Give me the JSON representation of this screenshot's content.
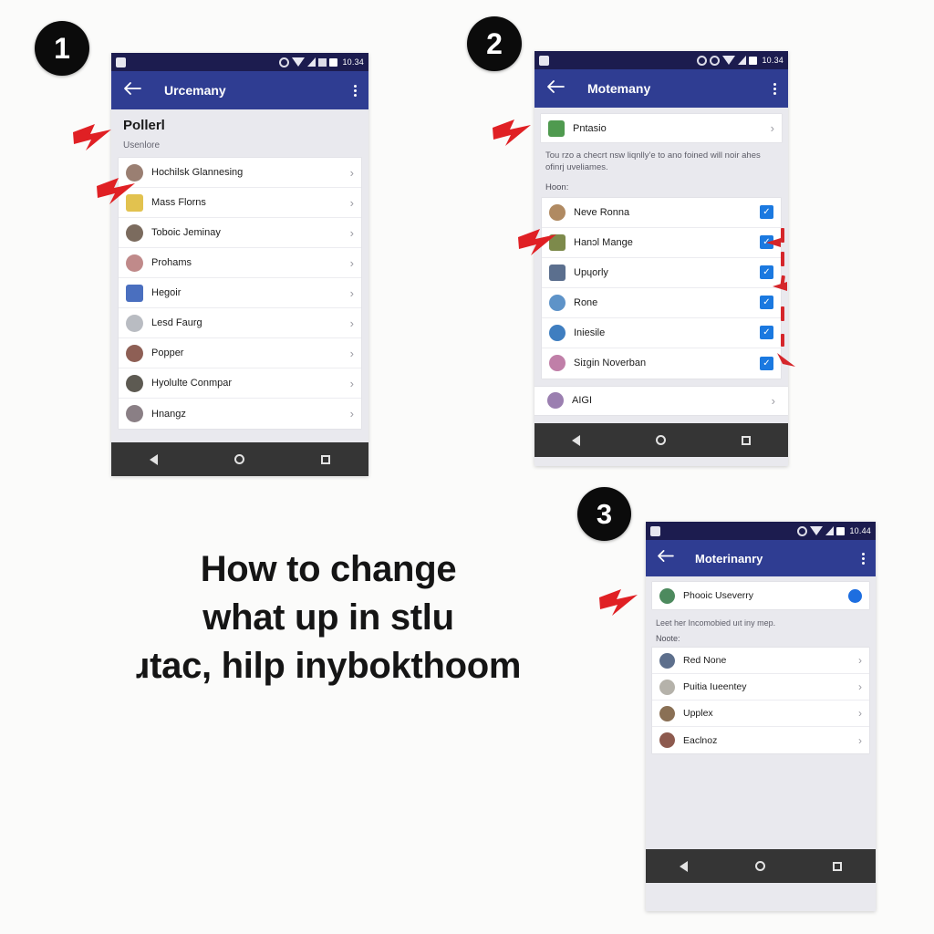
{
  "page": {
    "background": "#fbfbfa",
    "heading_lines": [
      "How to change",
      "what up in stlu",
      "ɹtac, hilp inybokthoom"
    ]
  },
  "colors": {
    "statusbar": "#1c1c4f",
    "appbar": "#2f3d92",
    "checkbox": "#1b79e0",
    "toggle_dot": "#1d6ee0",
    "arrow_red": "#e02024",
    "navbar": "#353535",
    "badge": "#0b0b0b"
  },
  "steps": [
    {
      "number": "1"
    },
    {
      "number": "2"
    },
    {
      "number": "3"
    }
  ],
  "phone1": {
    "statusbar": {
      "time": "10.34",
      "icons": [
        "app-notification-icon",
        "gear-icon",
        "wifi-icon",
        "signal-icon",
        "battery-icon"
      ]
    },
    "appbar": {
      "back_icon": "back-arrow-icon",
      "title": "Urcemany",
      "menu_icon": "overflow-menu-icon"
    },
    "section": {
      "title": "Pollerl",
      "subtitle": "Usenlore"
    },
    "rows": [
      {
        "label": "Hochilsk Glannesing",
        "avatar": "#9a7f72",
        "square": false
      },
      {
        "label": "Mass Florns",
        "avatar": "#e2c24f",
        "square": true
      },
      {
        "label": "Toboic Jeminay",
        "avatar": "#7b6b5e",
        "square": false
      },
      {
        "label": "Prohams",
        "avatar": "#c08a8a",
        "square": false
      },
      {
        "label": "Hegoir",
        "avatar": "#4a6fbf",
        "square": true
      },
      {
        "label": "Lesd Faurg",
        "avatar": "#b9bcc2",
        "square": false
      },
      {
        "label": "Popper",
        "avatar": "#8e5f55",
        "square": false
      },
      {
        "label": "Hyolulte Conmpar",
        "avatar": "#5d5a52",
        "square": false
      },
      {
        "label": "Hnangz",
        "avatar": "#8a7f85",
        "square": false
      }
    ],
    "navbar": {
      "back": "nav-back-icon",
      "home": "nav-home-icon",
      "recents": "nav-recents-icon"
    }
  },
  "phone2": {
    "statusbar": {
      "time": "10.34",
      "icons": [
        "app-notification-icon",
        "gear-icon",
        "gear-icon",
        "wifi-icon",
        "signal-icon",
        "battery-icon"
      ]
    },
    "appbar": {
      "back_icon": "back-arrow-icon",
      "title": "Motemany",
      "menu_icon": "overflow-menu-icon"
    },
    "top_item": {
      "label": "Pntasio",
      "avatar": "#4f9a4f"
    },
    "description": "Tou rzo a checrt nsw liqnlly'e to ano foined will noir ahes ofinrj uveliames.",
    "note_label": "Hoon:",
    "rows": [
      {
        "label": "Neve Ronna",
        "avatar": "#b08a62",
        "checked": true,
        "square": false
      },
      {
        "label": "Hanɔl Mange",
        "avatar": "#7d8a4b",
        "checked": true,
        "square": true
      },
      {
        "label": "Upɥorly",
        "avatar": "#5b6f8e",
        "checked": true,
        "square": true
      },
      {
        "label": "Rone",
        "avatar": "#5e93c8",
        "checked": true,
        "square": false
      },
      {
        "label": "Iniesile",
        "avatar": "#3f7ec0",
        "checked": true,
        "square": false
      },
      {
        "label": "Siɪgin Noverban",
        "avatar": "#c07fa8",
        "checked": true,
        "square": false
      }
    ],
    "bottom_item": {
      "label": "AIGI",
      "avatar": "#9b7fb0"
    },
    "navbar": {
      "back": "nav-back-icon",
      "home": "nav-home-icon",
      "recents": "nav-recents-icon"
    }
  },
  "phone3": {
    "statusbar": {
      "time": "10.44",
      "icons": [
        "app-notification-icon",
        "gear-icon",
        "wifi-icon",
        "signal-icon",
        "battery-icon"
      ]
    },
    "appbar": {
      "back_icon": "back-arrow-icon",
      "title": "Moterinanry",
      "menu_icon": "overflow-menu-icon"
    },
    "top_item": {
      "label": "Phooic Useverry",
      "avatar": "#4d8a5e",
      "toggle_on": true
    },
    "description": "Leet her Incomobied uıt iny mep.",
    "note_label": "Noote:",
    "rows": [
      {
        "label": "Red None",
        "avatar": "#5d6f8c"
      },
      {
        "label": "Puitia Iueentey",
        "avatar": "#b5b2aa"
      },
      {
        "label": "Upplex",
        "avatar": "#8a7055"
      },
      {
        "label": "Eaclnoz",
        "avatar": "#8d5a4e"
      }
    ],
    "navbar": {
      "back": "nav-back-icon",
      "home": "nav-home-icon",
      "recents": "nav-recents-icon"
    }
  }
}
